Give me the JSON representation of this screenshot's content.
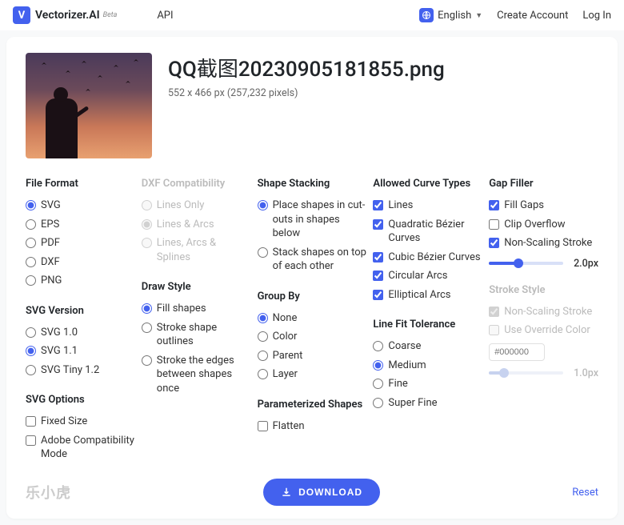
{
  "header": {
    "brand": "Vectorizer.AI",
    "beta": "Beta",
    "api": "API",
    "language": "English",
    "create_account": "Create Account",
    "log_in": "Log In"
  },
  "file": {
    "name": "QQ截图20230905181855.png",
    "meta": "552 x 466 px (257,232 pixels)"
  },
  "sections": {
    "file_format": {
      "title": "File Format",
      "options": [
        "SVG",
        "EPS",
        "PDF",
        "DXF",
        "PNG"
      ],
      "selected": "SVG"
    },
    "svg_version": {
      "title": "SVG Version",
      "options": [
        "SVG 1.0",
        "SVG 1.1",
        "SVG Tiny 1.2"
      ],
      "selected": "SVG 1.1"
    },
    "svg_options": {
      "title": "SVG Options",
      "options": [
        "Fixed Size",
        "Adobe Compatibility Mode"
      ],
      "checked": []
    },
    "dxf_compat": {
      "title": "DXF Compatibility",
      "options": [
        "Lines Only",
        "Lines & Arcs",
        "Lines, Arcs & Splines"
      ],
      "selected": "Lines & Arcs",
      "disabled": true
    },
    "draw_style": {
      "title": "Draw Style",
      "options": [
        "Fill shapes",
        "Stroke shape outlines",
        "Stroke the edges between shapes once"
      ],
      "selected": "Fill shapes"
    },
    "shape_stacking": {
      "title": "Shape Stacking",
      "options": [
        "Place shapes in cut-outs in shapes below",
        "Stack shapes on top of each other"
      ],
      "selected": "Place shapes in cut-outs in shapes below"
    },
    "group_by": {
      "title": "Group By",
      "options": [
        "None",
        "Color",
        "Parent",
        "Layer"
      ],
      "selected": "None"
    },
    "param_shapes": {
      "title": "Parameterized Shapes",
      "options": [
        "Flatten"
      ],
      "checked": []
    },
    "curve_types": {
      "title": "Allowed Curve Types",
      "options": [
        "Lines",
        "Quadratic Bézier Curves",
        "Cubic Bézier Curves",
        "Circular Arcs",
        "Elliptical Arcs"
      ],
      "checked": [
        "Lines",
        "Quadratic Bézier Curves",
        "Cubic Bézier Curves",
        "Circular Arcs",
        "Elliptical Arcs"
      ]
    },
    "line_fit": {
      "title": "Line Fit Tolerance",
      "options": [
        "Coarse",
        "Medium",
        "Fine",
        "Super Fine"
      ],
      "selected": "Medium"
    },
    "gap_filler": {
      "title": "Gap Filler",
      "options": [
        "Fill Gaps",
        "Clip Overflow",
        "Non-Scaling Stroke"
      ],
      "checked": [
        "Fill Gaps",
        "Non-Scaling Stroke"
      ],
      "slider_value": "2.0px",
      "slider_pct": 40
    },
    "stroke_style": {
      "title": "Stroke Style",
      "options": [
        "Non-Scaling Stroke",
        "Use Override Color"
      ],
      "checked": [
        "Non-Scaling Stroke"
      ],
      "color_placeholder": "#000000",
      "slider_value": "1.0px",
      "slider_pct": 20,
      "disabled": true
    }
  },
  "footer": {
    "watermark": "乐小虎",
    "download": "DOWNLOAD",
    "reset": "Reset"
  }
}
